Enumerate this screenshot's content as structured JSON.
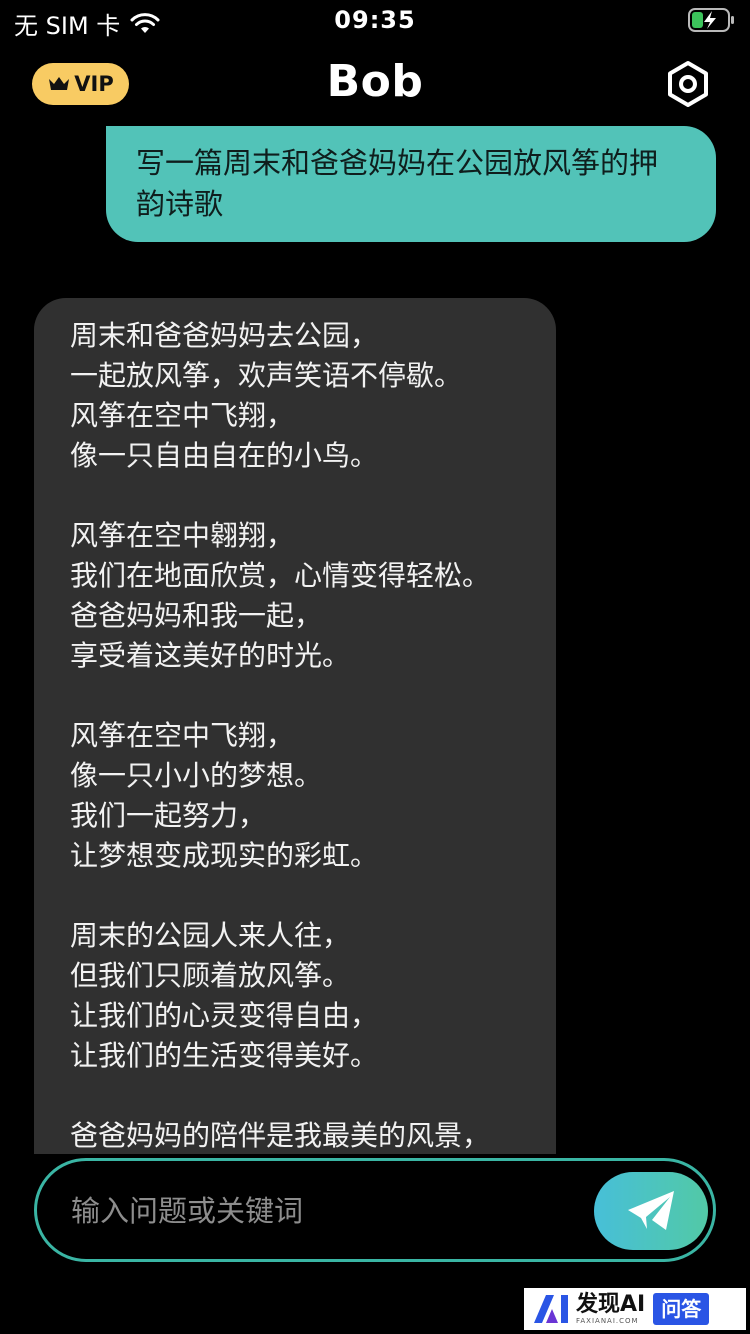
{
  "status_bar": {
    "carrier": "无 SIM 卡",
    "time": "09:35"
  },
  "header": {
    "vip_label": "VIP",
    "title": "Bob"
  },
  "chat": {
    "user_message": "写一篇周末和爸爸妈妈在公园放风筝的押韵诗歌",
    "bot_stanzas": [
      [
        "周末和爸爸妈妈去公园，",
        "一起放风筝，欢声笑语不停歇。",
        "风筝在空中飞翔，",
        "像一只自由自在的小鸟。"
      ],
      [
        "风筝在空中翱翔，",
        "我们在地面欣赏，心情变得轻松。",
        "爸爸妈妈和我一起，",
        "享受着这美好的时光。"
      ],
      [
        "风筝在空中飞翔，",
        "像一只小小的梦想。",
        "我们一起努力，",
        "让梦想变成现实的彩虹。"
      ],
      [
        "周末的公园人来人往，",
        "但我们只顾着放风筝。",
        "让我们的心灵变得自由，",
        "让我们的生活变得美好。"
      ],
      [
        "爸爸妈妈的陪伴是我最美的风景，"
      ]
    ]
  },
  "input": {
    "placeholder": "输入问题或关键词"
  },
  "watermark": {
    "main": "发现AI",
    "sub": "FAXIANAI.COM",
    "tag": "问答"
  },
  "colors": {
    "accent": "#52c3b8",
    "vip": "#f8cb63",
    "bot_bubble": "#303030",
    "background": "#000000"
  },
  "icons": {
    "signal": "wifi-icon",
    "battery": "battery-charging-icon",
    "vip": "crown-icon",
    "settings": "gear-icon",
    "send": "paper-plane-icon"
  }
}
